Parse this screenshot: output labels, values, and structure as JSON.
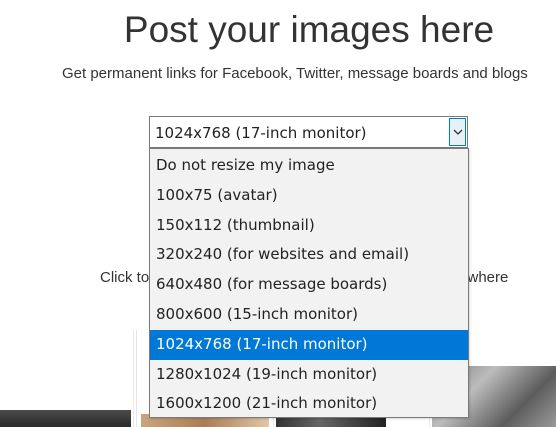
{
  "header": {
    "title": "Post your images here",
    "subtitle": "Get permanent links for Facebook, Twitter, message boards and blogs"
  },
  "instructions": {
    "left_fragment": "Click to",
    "right_fragment": "ywhere"
  },
  "resize_select": {
    "selected_value": "1024x768 (17-inch monitor)",
    "arrow_icon": "chevron-down-icon",
    "options": [
      "Do not resize my image",
      "100x75 (avatar)",
      "150x112 (thumbnail)",
      "320x240 (for websites and email)",
      "640x480 (for message boards)",
      "800x600 (15-inch monitor)",
      "1024x768 (17-inch monitor)",
      "1280x1024 (19-inch monitor)",
      "1600x1200 (21-inch monitor)"
    ],
    "highlighted_option": "1024x768 (17-inch monitor)",
    "highlight_color": "#0078d7"
  }
}
